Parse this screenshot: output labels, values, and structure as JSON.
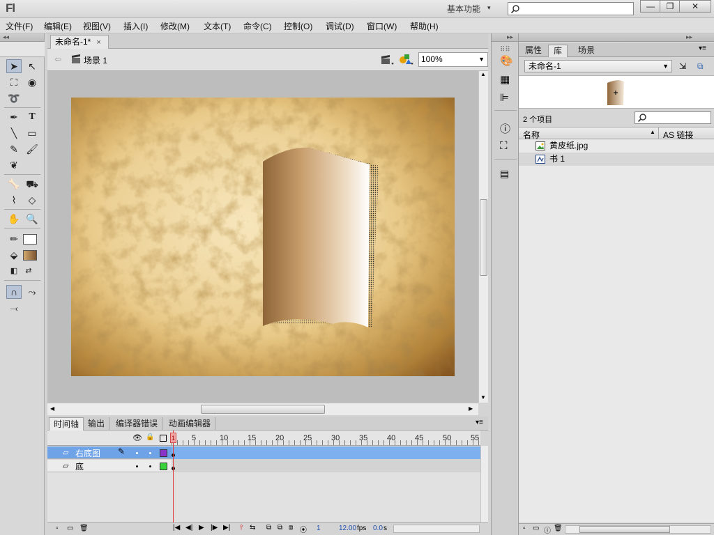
{
  "app": {
    "logo": "Fl",
    "workspace": "基本功能",
    "workspace_caret": "▾"
  },
  "window_buttons": {
    "minimize": "—",
    "restore": "❐",
    "close": "✕"
  },
  "menu": [
    "文件(F)",
    "编辑(E)",
    "视图(V)",
    "插入(I)",
    "修改(M)",
    "文本(T)",
    "命令(C)",
    "控制(O)",
    "调试(D)",
    "窗口(W)",
    "帮助(H)"
  ],
  "document": {
    "tab": "未命名-1*",
    "close": "×",
    "scene": "场景 1",
    "zoom": "100%"
  },
  "timeline": {
    "tabs": [
      "时间轴",
      "输出",
      "编译器错误",
      "动画编辑器"
    ],
    "frame_numbers": [
      "1",
      "5",
      "10",
      "15",
      "20",
      "25",
      "30",
      "35",
      "40",
      "45",
      "50",
      "55"
    ],
    "layers": [
      {
        "name": "右底图",
        "color": "#8a33c9",
        "selected": true
      },
      {
        "name": "底",
        "color": "#3ad33a",
        "selected": false
      }
    ],
    "current_frame": "1",
    "fps": "12.00",
    "fps_unit": "fps",
    "time": "0.0",
    "time_unit": "s"
  },
  "library": {
    "tabs": [
      "属性",
      "库",
      "场景"
    ],
    "document": "未命名-1",
    "item_count": "2 个项目",
    "columns": {
      "name": "名称",
      "linkage": "AS 链接"
    },
    "items": [
      {
        "name": "黄皮纸.jpg",
        "icon": "bitmap-icon"
      },
      {
        "name": "书 1",
        "icon": "graphic-symbol-icon"
      }
    ]
  },
  "colors": {
    "selected_layer": "#6fa3e8",
    "playhead": "#e23a3a",
    "stage_paper": "#ecd196"
  }
}
